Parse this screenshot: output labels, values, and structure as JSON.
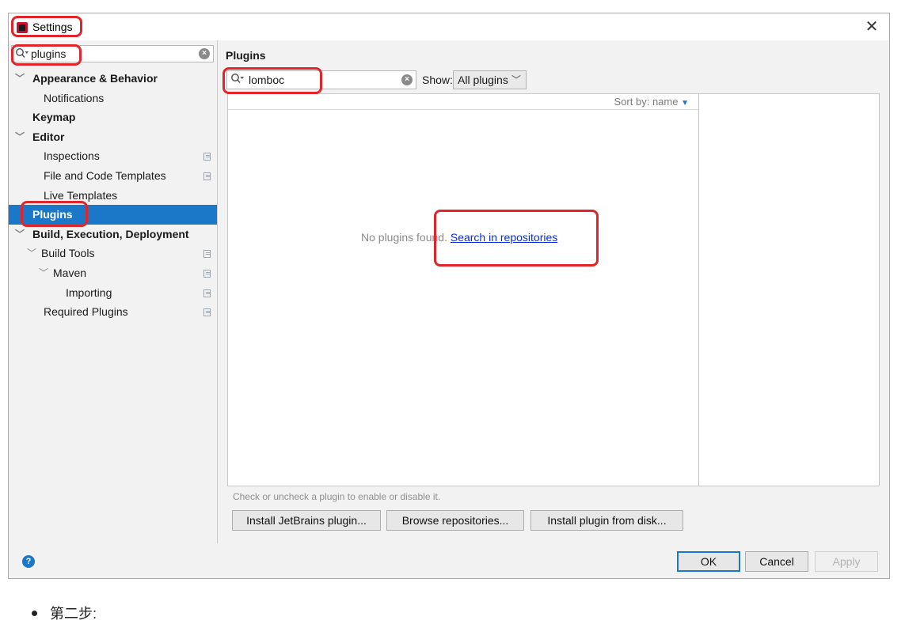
{
  "window": {
    "title": "Settings",
    "close_glyph": "✕",
    "icon": "intellij-app-icon"
  },
  "sidebar": {
    "search_value": "plugins",
    "items": [
      {
        "label": "Appearance & Behavior",
        "level": 0,
        "bold": true,
        "expanded": true,
        "copy_icon": false
      },
      {
        "label": "Notifications",
        "level": 1,
        "bold": false,
        "copy_icon": false
      },
      {
        "label": "Keymap",
        "level": 0,
        "bold": true,
        "copy_icon": false
      },
      {
        "label": "Editor",
        "level": 0,
        "bold": true,
        "expanded": true,
        "copy_icon": false
      },
      {
        "label": "Inspections",
        "level": 1,
        "bold": false,
        "copy_icon": true
      },
      {
        "label": "File and Code Templates",
        "level": 1,
        "bold": false,
        "copy_icon": true
      },
      {
        "label": "Live Templates",
        "level": 1,
        "bold": false,
        "copy_icon": false
      },
      {
        "label": "Plugins",
        "level": 0,
        "bold": true,
        "selected": true,
        "copy_icon": false
      },
      {
        "label": "Build, Execution, Deployment",
        "level": 0,
        "bold": true,
        "expanded": true,
        "copy_icon": false
      },
      {
        "label": "Build Tools",
        "level": 1,
        "bold": false,
        "expanded": true,
        "copy_icon": true
      },
      {
        "label": "Maven",
        "level": 2,
        "bold": false,
        "expanded": true,
        "copy_icon": true
      },
      {
        "label": "Importing",
        "level": 3,
        "bold": false,
        "copy_icon": true
      },
      {
        "label": "Required Plugins",
        "level": 1,
        "bold": false,
        "copy_icon": true
      }
    ]
  },
  "main": {
    "section_title": "Plugins",
    "search_value": "lomboc",
    "show_label": "Show:",
    "show_value": "All plugins",
    "sort_label": "Sort by: name",
    "empty_text": "No plugins found.",
    "empty_link": "Search in repositories",
    "hint": "Check or uncheck a plugin to enable or disable it.",
    "buttons": {
      "install_jetbrains": "Install JetBrains plugin...",
      "browse": "Browse repositories...",
      "install_disk": "Install plugin from disk..."
    }
  },
  "footer": {
    "help": "?",
    "ok": "OK",
    "cancel": "Cancel",
    "apply": "Apply"
  },
  "caption": {
    "step": "第二步:"
  },
  "colors": {
    "selection": "#1b77c8",
    "annotation": "#e0262b",
    "link": "#0b2dd4"
  }
}
